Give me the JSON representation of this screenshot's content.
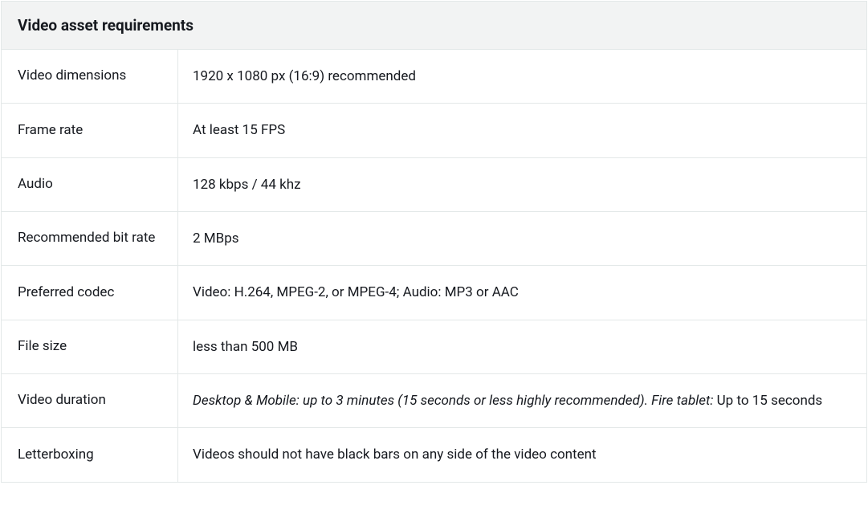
{
  "table": {
    "header": "Video asset requirements",
    "rows": [
      {
        "label": "Video dimensions",
        "value": "1920 x 1080 px (16:9) recommended"
      },
      {
        "label": "Frame rate",
        "value": "At least 15 FPS"
      },
      {
        "label": "Audio",
        "value": "128 kbps / 44 khz"
      },
      {
        "label": "Recommended bit rate",
        "value": "2 MBps"
      },
      {
        "label": "Preferred codec",
        "value": "Video: H.264, MPEG-2, or MPEG-4; Audio: MP3 or AAC"
      },
      {
        "label": "File size",
        "value": "less than 500 MB"
      },
      {
        "label": "Video duration",
        "value_italic": "Desktop & Mobile: up to 3 minutes (15 seconds or less highly recommended). Fire tablet:",
        "value_after": " Up to 15 seconds"
      },
      {
        "label": "Letterboxing",
        "value": "Videos should not have black bars on any side of the video content"
      }
    ]
  }
}
